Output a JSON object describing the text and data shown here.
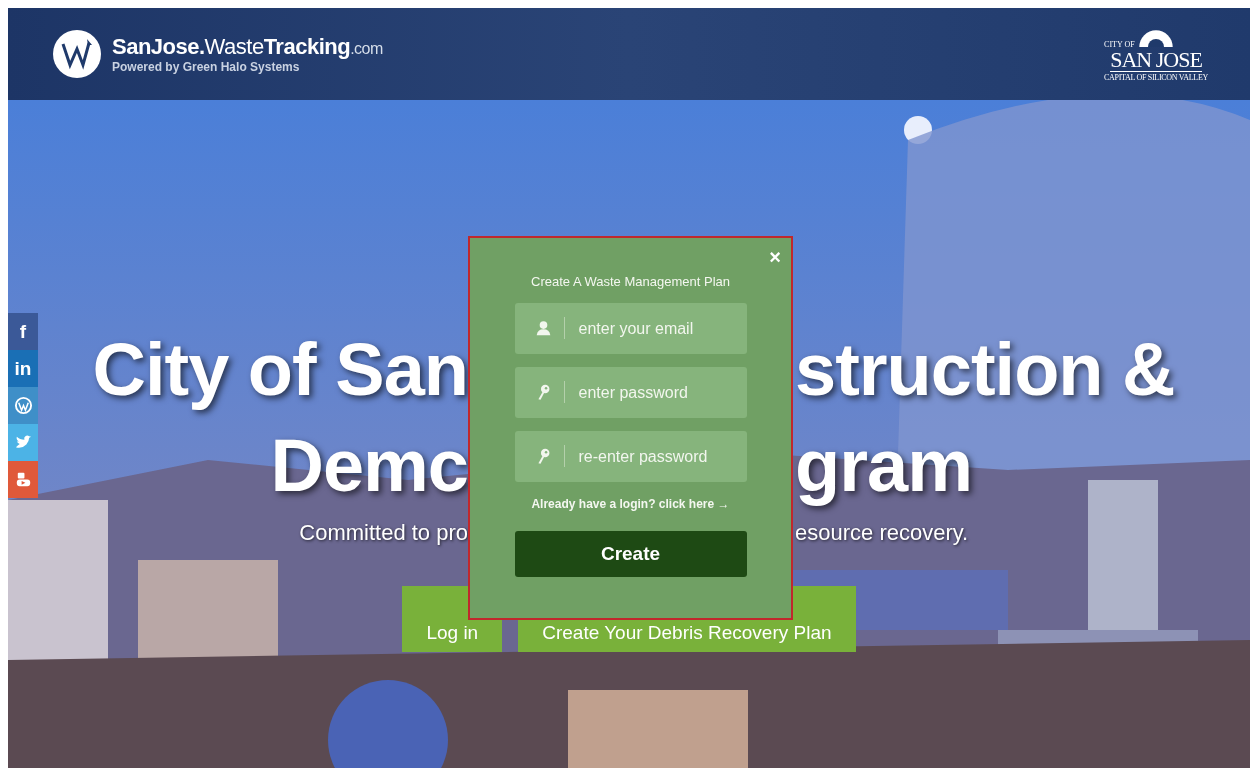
{
  "header": {
    "brand_bold": "SanJose.",
    "brand_light": "Waste",
    "brand_bold2": "Tracking",
    "brand_suffix": ".com",
    "tagline": "Powered by Green Halo Systems",
    "city_logo": {
      "small": "CITY OF",
      "name": "SAN JOSE",
      "motto": "CAPITAL OF SILICON VALLEY"
    }
  },
  "social": [
    {
      "kind": "facebook",
      "label": "f",
      "color": "#3b5998"
    },
    {
      "kind": "linkedin",
      "label": "in",
      "color": "#1a6fb5"
    },
    {
      "kind": "wordpress",
      "color": "#3f8fc8"
    },
    {
      "kind": "twitter",
      "color": "#4cb3e6"
    },
    {
      "kind": "youtube",
      "color": "#e0593a"
    }
  ],
  "hero": {
    "headline": [
      {
        "left": "City of San",
        "right": "struction &"
      },
      {
        "left": "Demc",
        "right": "gram"
      }
    ],
    "subtitle": {
      "left": "Committed to pro",
      "right": "esource recovery."
    },
    "buttons": [
      "Log in",
      "Create Your Debris Recovery Plan"
    ]
  },
  "modal": {
    "close": "×",
    "title": "Create A Waste Management Plan",
    "fields": [
      {
        "kind": "user",
        "placeholder": "enter your email"
      },
      {
        "kind": "key",
        "placeholder": "enter password"
      },
      {
        "kind": "key",
        "placeholder": "re-enter password"
      }
    ],
    "login_link": "Already have a login? click here →",
    "submit": "Create"
  }
}
